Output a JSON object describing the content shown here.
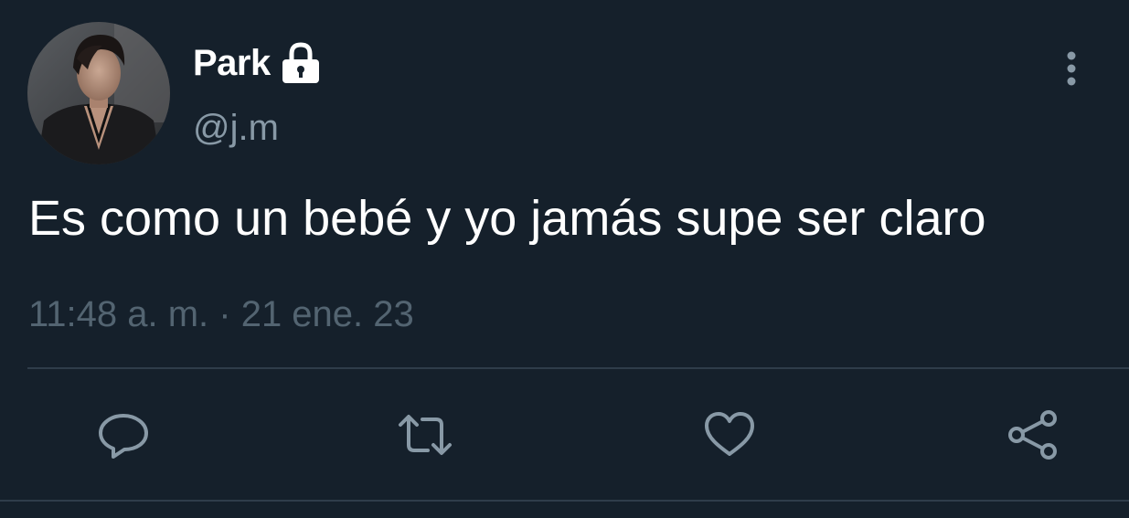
{
  "user": {
    "display_name": "Park",
    "handle": "@j.m",
    "lock_icon": "lock-icon",
    "avatar": "profile-photo"
  },
  "tweet": {
    "text": "Es como un bebé y yo jamás supe ser claro",
    "timestamp": "11:48 a. m. · 21 ene. 23"
  },
  "actions": {
    "reply_icon": "comment-icon",
    "retweet_icon": "retweet-icon",
    "like_icon": "heart-icon",
    "share_icon": "share-icon"
  },
  "menu_icon": "more-vertical-icon",
  "colors": {
    "background": "#15202b",
    "primary_text": "#ffffff",
    "secondary_text": "#8899a6",
    "timestamp_text": "#536471",
    "divider": "#2f3d4a",
    "icon": "#8899a6"
  }
}
